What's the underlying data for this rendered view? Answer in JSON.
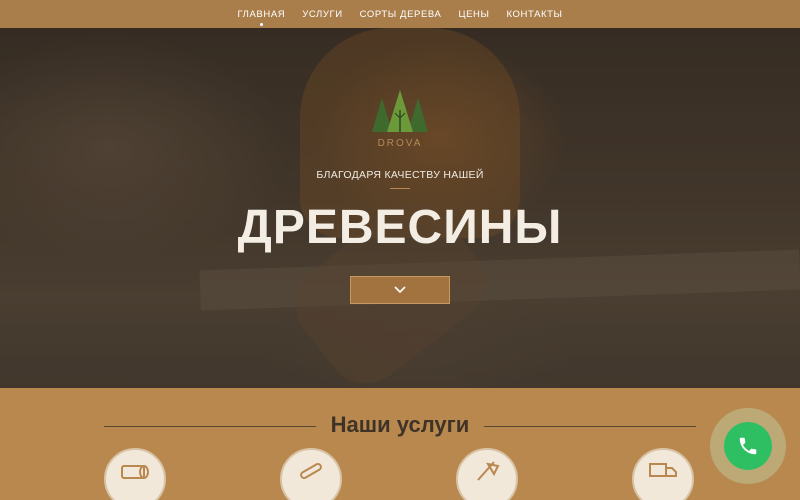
{
  "nav": {
    "items": [
      {
        "label": "ГЛАВНАЯ",
        "active": true
      },
      {
        "label": "УСЛУГИ",
        "active": false
      },
      {
        "label": "СОРТЫ ДЕРЕВА",
        "active": false
      },
      {
        "label": "ЦЕНЫ",
        "active": false
      },
      {
        "label": "КОНТАКТЫ",
        "active": false
      }
    ]
  },
  "hero": {
    "logo_text": "DROVA",
    "subtitle": "БЛАГОДАРЯ КАЧЕСТВУ НАШЕЙ",
    "title": "ДРЕВЕСИНЫ",
    "scroll_icon": "chevron-down-icon"
  },
  "services": {
    "title": "Наши услуги",
    "icons": [
      "log-icon",
      "chainsaw-icon",
      "axe-icon",
      "truck-icon"
    ]
  },
  "call": {
    "icon": "phone-icon"
  },
  "colors": {
    "accent": "#b8884f",
    "nav_bg": "#a97e4a",
    "button_bg": "#a2733f",
    "call_green": "#2fbf63",
    "title_text": "#3e3326"
  }
}
